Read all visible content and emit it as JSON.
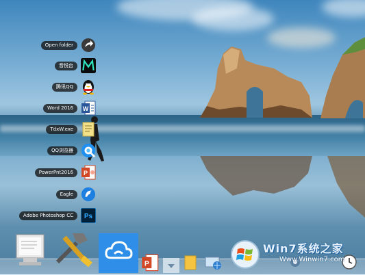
{
  "jump_list": {
    "items": [
      {
        "label": "Open folder",
        "icon": "open-folder-arrow-icon"
      },
      {
        "label": "音悦台",
        "icon": "yinyuetai-icon"
      },
      {
        "label": "腾讯QQ",
        "icon": "qq-penguin-icon"
      },
      {
        "label": "Word 2016",
        "icon": "word-icon"
      },
      {
        "label": "TdxW.exe",
        "icon": "tdxw-icon"
      },
      {
        "label": "QQ浏览器",
        "icon": "qq-browser-icon"
      },
      {
        "label": "PowerPnt2016",
        "icon": "powerpoint-icon"
      },
      {
        "label": "Eagle",
        "icon": "eagle-icon"
      },
      {
        "label": "Adobe Photoshop CC",
        "icon": "photoshop-icon"
      }
    ]
  },
  "dock": {
    "items": [
      "system-monitor-icon",
      "tools-icon",
      "cloud-sync-icon",
      "powerpoint-icon",
      "chevron-down-icon",
      "folder-icon",
      "network-globe-icon",
      "windows-logo-icon",
      "settings-icon",
      "clock-icon"
    ]
  },
  "watermark": {
    "brand": "Win7系统之家",
    "url": "Www.Winwin7.com"
  },
  "colors": {
    "label_bg": "#1a1a1a",
    "word_blue": "#2b579a",
    "ppt_orange": "#d24726",
    "ps_dark": "#001e36",
    "cloud_blue": "#2f8fe8"
  }
}
